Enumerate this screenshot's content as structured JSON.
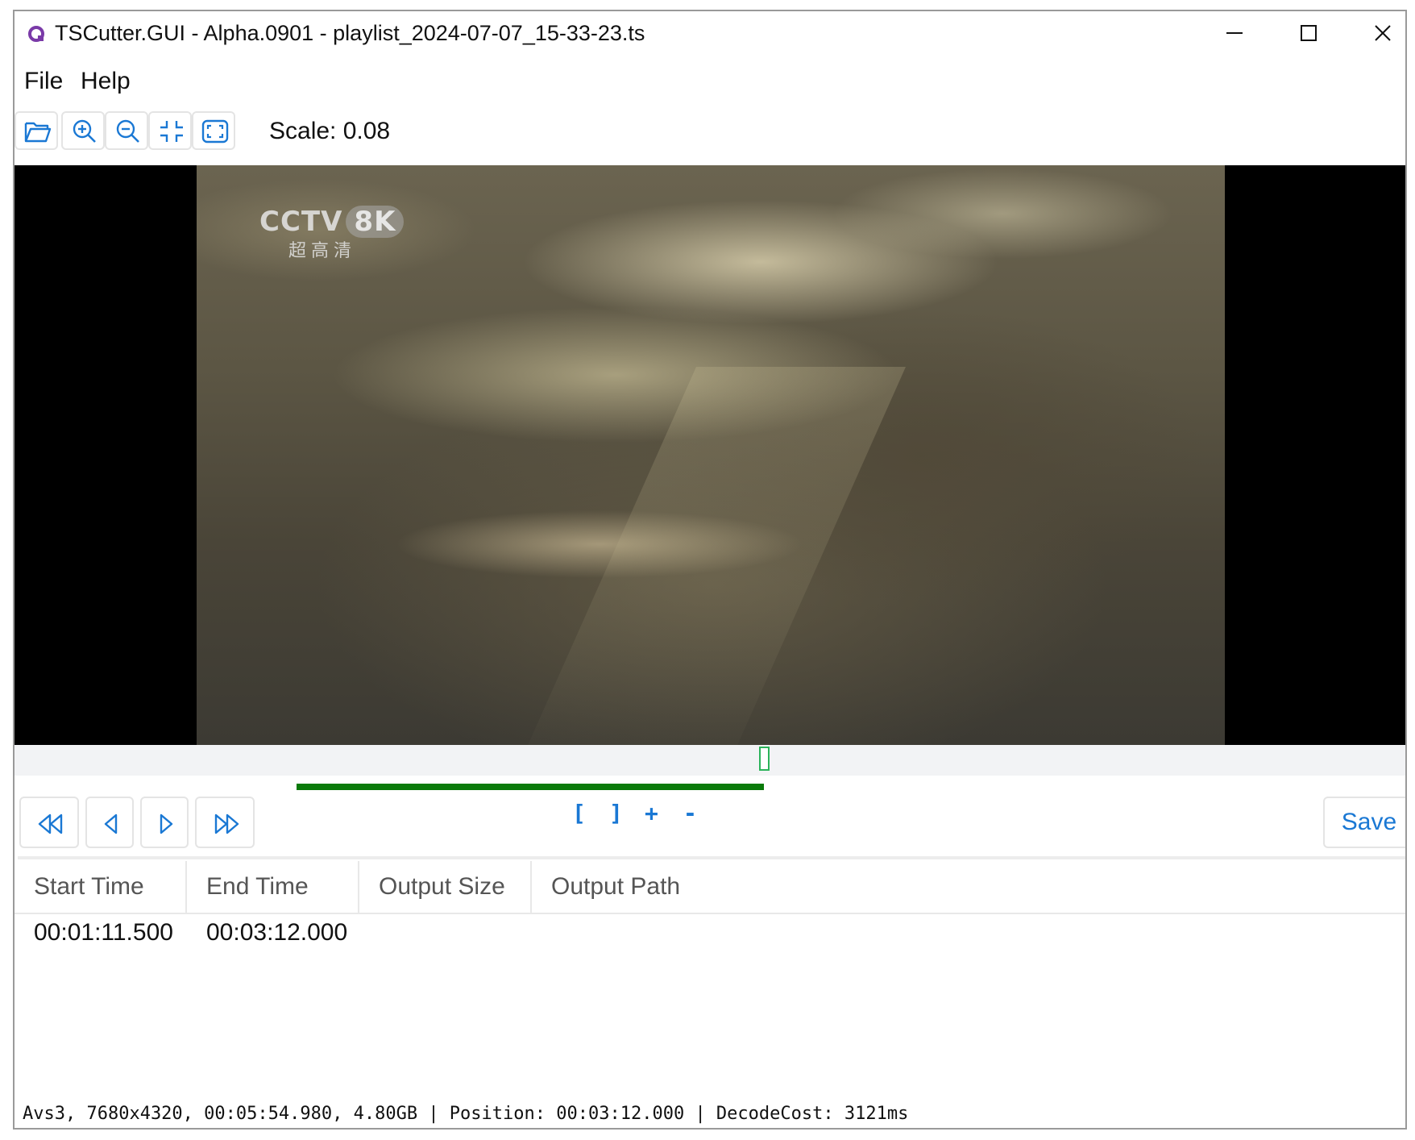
{
  "window": {
    "title": "TSCutter.GUI - Alpha.0901 - playlist_2024-07-07_15-33-23.ts",
    "app_icon": "app-logo-icon",
    "controls": [
      "minimize-icon",
      "maximize-icon",
      "close-icon"
    ]
  },
  "menu": {
    "file": "File",
    "help": "Help"
  },
  "toolbar": {
    "icons": [
      "folder-open-icon",
      "zoom-in-icon",
      "zoom-out-icon",
      "fit-inward-icon",
      "fullscreen-icon"
    ],
    "scale_label": "Scale: 0.08"
  },
  "video": {
    "watermark_main": "CCTV",
    "watermark_badge": "8K",
    "watermark_sub": "超高清"
  },
  "timeline": {
    "marker_position": 0.539,
    "segment_start": 0.203,
    "segment_end": 0.539
  },
  "controls": {
    "icons": [
      "fast-rewind-icon",
      "step-back-icon",
      "step-forward-icon",
      "fast-forward-icon"
    ],
    "mark_start": "[",
    "mark_end": "]",
    "add": "+",
    "remove": "-",
    "save": "Save"
  },
  "table": {
    "headers": [
      "Start Time",
      "End Time",
      "Output Size",
      "Output Path"
    ],
    "rows": [
      {
        "start": "00:01:11.500",
        "end": "00:03:12.000",
        "size": "",
        "path": ""
      }
    ]
  },
  "status": "Avs3, 7680x4320, 00:05:54.980, 4.80GB | Position: 00:03:12.000 | DecodeCost: 3121ms",
  "colors": {
    "accent": "#1a78d4",
    "segment": "#0a7a0a",
    "marker": "#2bb35a"
  }
}
